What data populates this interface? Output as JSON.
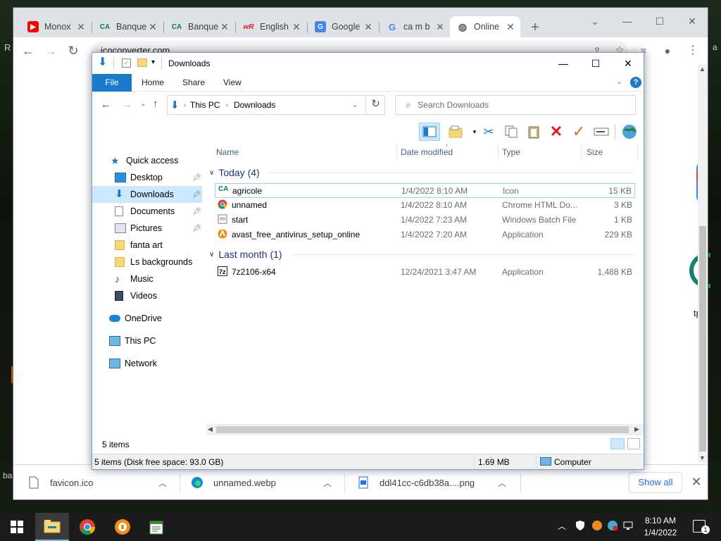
{
  "browser": {
    "tabs": [
      {
        "title": "Monox",
        "icon": "youtube-icon"
      },
      {
        "title": "Banque",
        "icon": "credit-agricole-icon"
      },
      {
        "title": "Banque",
        "icon": "credit-agricole-icon"
      },
      {
        "title": "English",
        "icon": "wordreference-icon"
      },
      {
        "title": "Google",
        "icon": "google-translate-icon"
      },
      {
        "title": "ca m b",
        "icon": "google-icon"
      },
      {
        "title": "Online",
        "icon": "globe-icon",
        "active": true
      }
    ],
    "close_glyph": "✕",
    "new_tab": "+",
    "url": "icoconverter.com",
    "page_fragments": {
      "left_r": "R",
      "right_tps": "tps",
      "right_a": "a"
    }
  },
  "downloads_bar": {
    "items": [
      {
        "name": "favicon.ico",
        "icon": "file-icon"
      },
      {
        "name": "unnamed.webp",
        "icon": "edge-icon"
      },
      {
        "name": "ddl41cc-c6db38a....png",
        "icon": "image-icon"
      }
    ],
    "show_all": "Show all"
  },
  "explorer": {
    "title": "Downloads",
    "ribbon_tabs": [
      "File",
      "Home",
      "Share",
      "View"
    ],
    "breadcrumb": [
      "This PC",
      "Downloads"
    ],
    "search_placeholder": "Search Downloads",
    "nav": {
      "quick_access": "Quick access",
      "items": [
        {
          "label": "Desktop",
          "pinned": true
        },
        {
          "label": "Downloads",
          "pinned": true,
          "selected": true
        },
        {
          "label": "Documents",
          "pinned": true
        },
        {
          "label": "Pictures",
          "pinned": true
        },
        {
          "label": "fanta art",
          "pinned": false
        },
        {
          "label": "Ls backgrounds",
          "pinned": false
        },
        {
          "label": "Music",
          "pinned": false
        },
        {
          "label": "Videos",
          "pinned": false
        }
      ],
      "onedrive": "OneDrive",
      "this_pc": "This PC",
      "network": "Network"
    },
    "columns": [
      "Name",
      "Date modified",
      "Type",
      "Size"
    ],
    "groups": [
      {
        "label": "Today (4)",
        "files": [
          {
            "name": "agricole",
            "date": "1/4/2022 8:10 AM",
            "type": "Icon",
            "size": "15 KB",
            "icon": "credit-agricole-icon"
          },
          {
            "name": "unnamed",
            "date": "1/4/2022 8:10 AM",
            "type": "Chrome HTML Do...",
            "size": "3 KB",
            "icon": "chrome-icon"
          },
          {
            "name": "start",
            "date": "1/4/2022 7:23 AM",
            "type": "Windows Batch File",
            "size": "1 KB",
            "icon": "batch-file-icon"
          },
          {
            "name": "avast_free_antivirus_setup_online",
            "date": "1/4/2022 7:20 AM",
            "type": "Application",
            "size": "229 KB",
            "icon": "avast-icon"
          }
        ]
      },
      {
        "label": "Last month (1)",
        "files": [
          {
            "name": "7z2106-x64",
            "date": "12/24/2021 3:47 AM",
            "type": "Application",
            "size": "1,488 KB",
            "icon": "7zip-icon"
          }
        ]
      }
    ],
    "item_count": "5 items",
    "status_detail": "5 items (Disk free space: 93.0 GB)",
    "status_size": "1.69 MB",
    "status_location": "Computer"
  },
  "taskbar": {
    "apps": [
      "start-icon",
      "file-explorer-icon",
      "chrome-icon",
      "avast-secure-browser-icon",
      "notepad-icon"
    ],
    "time": "8:10 AM",
    "date": "1/4/2022",
    "notification_count": "1"
  },
  "colors": {
    "accent": "#1979ca",
    "selected": "#cce8ff",
    "group": "#1e3287"
  }
}
